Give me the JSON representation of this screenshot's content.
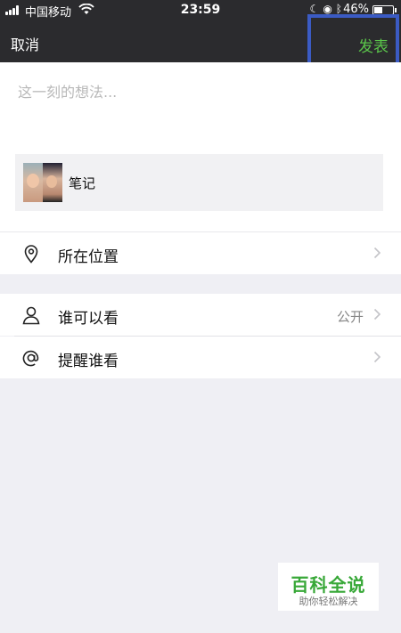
{
  "status_bar": {
    "carrier": "中国移动",
    "time": "23:59",
    "battery": "46%",
    "battery_level": 0.46
  },
  "nav": {
    "cancel_label": "取消",
    "publish_label": "发表"
  },
  "compose": {
    "placeholder": "这一刻的想法...",
    "attachment_label": "笔记"
  },
  "rows": {
    "location": {
      "label": "所在位置",
      "icon": "location-pin-icon"
    },
    "visibility": {
      "label": "谁可以看",
      "value": "公开",
      "icon": "person-icon"
    },
    "mention": {
      "label": "提醒谁看",
      "icon": "at-icon"
    }
  },
  "watermark": {
    "title": "百科全说",
    "subtitle": "助你轻松解决"
  },
  "colors": {
    "nav_background": "#2b2b2e",
    "publish_green": "#5ac44a",
    "highlight_box": "#3b5bc4",
    "page_background": "#efeff4",
    "watermark_green": "#38a838"
  }
}
